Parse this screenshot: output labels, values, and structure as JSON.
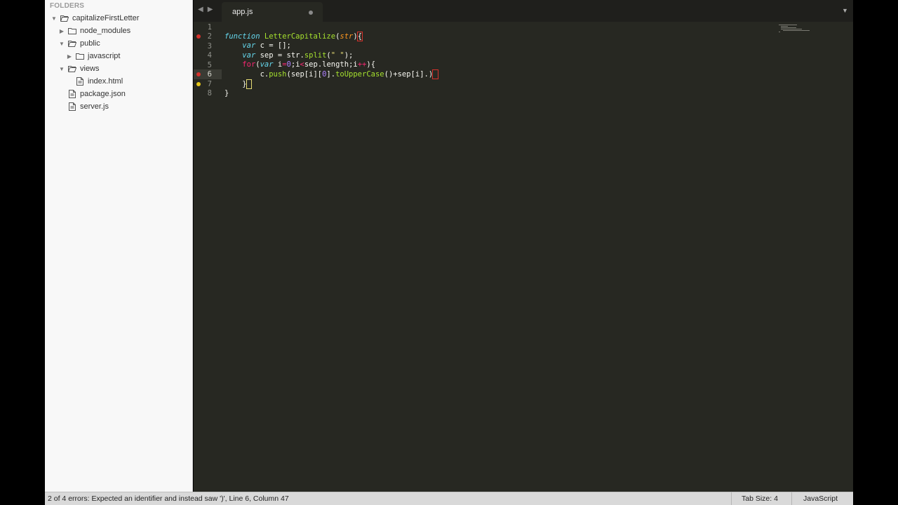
{
  "sidebar": {
    "title": "FOLDERS",
    "items": [
      {
        "label": "capitalizeFirstLetter",
        "type": "folder",
        "expanded": true,
        "depth": 0
      },
      {
        "label": "node_modules",
        "type": "folder",
        "expanded": false,
        "depth": 1
      },
      {
        "label": "public",
        "type": "folder",
        "expanded": true,
        "depth": 1
      },
      {
        "label": "javascript",
        "type": "folder",
        "expanded": false,
        "depth": 2
      },
      {
        "label": "views",
        "type": "folder",
        "expanded": true,
        "depth": 1
      },
      {
        "label": "index.html",
        "type": "file",
        "depth": 2
      },
      {
        "label": "package.json",
        "type": "file",
        "depth": 1
      },
      {
        "label": "server.js",
        "type": "file",
        "depth": 1
      }
    ]
  },
  "tabs": {
    "back_icon": "triangle-left",
    "forward_icon": "triangle-right",
    "active_tab": "app.js",
    "menu_icon": "triangle-down"
  },
  "editor": {
    "line_numbers": [
      "1",
      "2",
      "3",
      "4",
      "5",
      "6",
      "7",
      "8"
    ],
    "current_line": "6",
    "error_lines": [
      "2",
      "6"
    ],
    "warning_lines": [
      "7"
    ],
    "code": [
      "",
      "function LetterCapitalize(str){",
      "    var c = [];",
      "    var sep = str.split(\" \");",
      "    for(var i=0;i<sep.length;i++){",
      "        c.push(sep[i][0].toUpperCase()+sep[i].)",
      "    }",
      "}"
    ]
  },
  "statusbar": {
    "message": "2 of 4 errors: Expected an identifier and instead saw ')', Line 6, Column 47",
    "tab_size": "Tab Size: 4",
    "syntax": "JavaScript"
  },
  "colors": {
    "editor_bg": "#272822",
    "keyword": "#66d9ef",
    "function": "#a6e22e",
    "parameter": "#fd971f",
    "operator": "#f92672",
    "number": "#ae81ff",
    "string": "#e6db74",
    "error_marker": "#d6322c",
    "warning_marker": "#e6c719"
  }
}
